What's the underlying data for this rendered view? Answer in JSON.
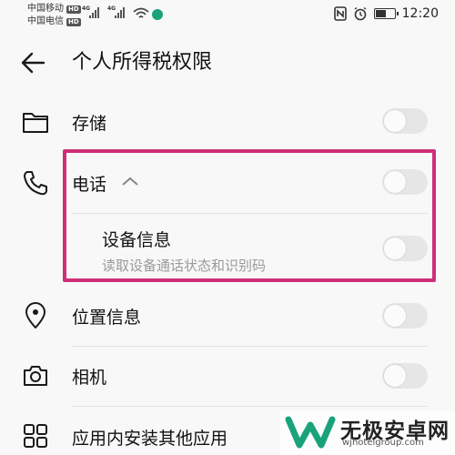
{
  "status": {
    "carrier1": "中国移动",
    "carrier2": "中国电信",
    "hd": "HD",
    "net1": "4G",
    "net2": "4G",
    "time": "12:20"
  },
  "header": {
    "title": "个人所得税权限"
  },
  "permissions": {
    "storage": {
      "label": "存储",
      "enabled": false
    },
    "phone": {
      "label": "电话",
      "enabled": false
    },
    "device_info": {
      "label": "设备信息",
      "description": "读取设备通话状态和识别码",
      "enabled": false
    },
    "location": {
      "label": "位置信息",
      "enabled": false
    },
    "camera": {
      "label": "相机",
      "enabled": false
    },
    "install_apps": {
      "label": "应用内安装其他应用"
    }
  },
  "watermark": {
    "brand": "无极安卓网",
    "url": "wjhotelgroup.com"
  },
  "colors": {
    "highlight": "#cf2f78",
    "toggle_off": "#e6e6e6",
    "watermark_logo": "#1aa37a"
  }
}
